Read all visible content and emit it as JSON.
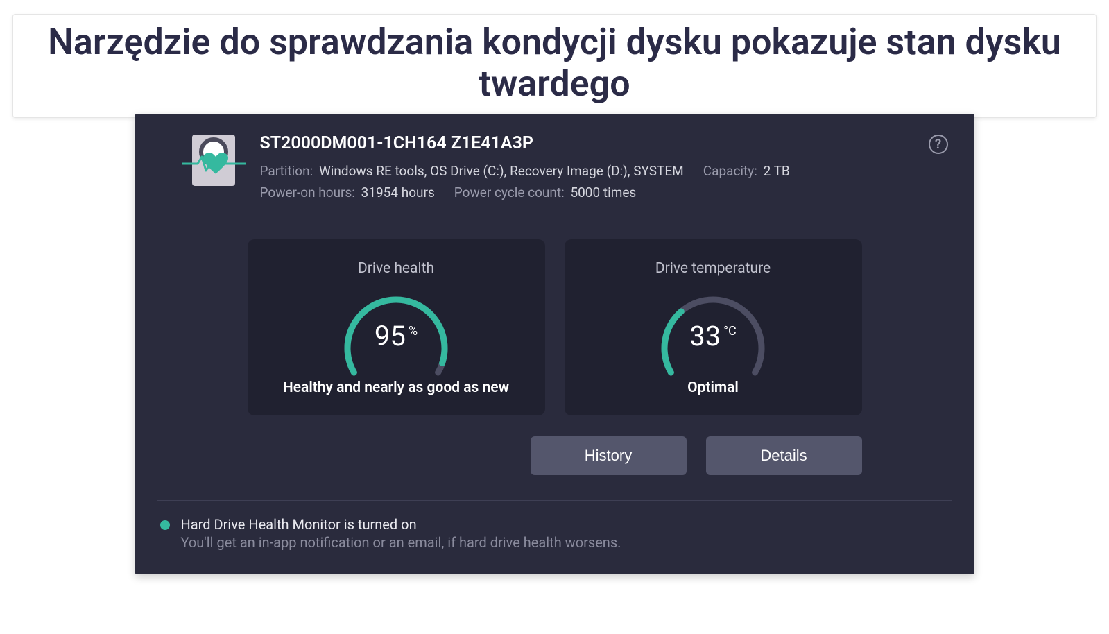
{
  "caption": "Narzędzie do sprawdzania kondycji dysku pokazuje stan dysku twardego",
  "drive": {
    "model": "ST2000DM001-1CH164 Z1E41A3P",
    "partition_label": "Partition:",
    "partition_value": "Windows RE tools, OS Drive (C:), Recovery Image (D:), SYSTEM",
    "capacity_label": "Capacity:",
    "capacity_value": "2 TB",
    "poweron_label": "Power-on hours:",
    "poweron_value": "31954 hours",
    "powercycle_label": "Power cycle count:",
    "powercycle_value": "5000 times"
  },
  "gauges": {
    "health": {
      "title": "Drive health",
      "value": "95",
      "unit": "%",
      "status": "Healthy and nearly as good as new",
      "fill_ratio": 0.95
    },
    "temp": {
      "title": "Drive temperature",
      "value": "33",
      "unit": "°C",
      "status": "Optimal",
      "fill_ratio": 0.33
    }
  },
  "buttons": {
    "history": "History",
    "details": "Details"
  },
  "footer": {
    "title": "Hard Drive Health Monitor is turned on",
    "sub": "You'll get an in-app notification or an email, if hard drive health worsens."
  },
  "colors": {
    "accent": "#35b99f",
    "track": "#4c4d62"
  }
}
